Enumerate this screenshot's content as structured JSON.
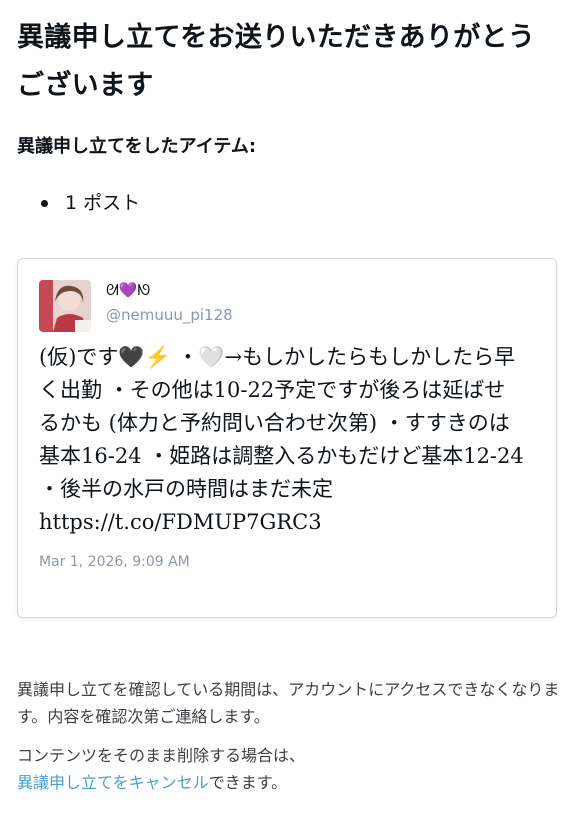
{
  "header": {
    "title": "異議申し立てをお送りいただきありがとうございます"
  },
  "appeal": {
    "items_heading": "異議申し立てをしたアイテム:",
    "items": [
      "1 ポスト"
    ]
  },
  "post": {
    "display_name": "ᘛ💜ᘚ",
    "handle": "@nemuuu_pi128",
    "text": "(仮)です🖤⚡ ・🤍→もしかしたらもしかしたら早く出勤 ・その他は10-22予定ですが後ろは延ばせるかも (体力と予約問い合わせ次第) ・すすきのは基本16-24 ・姫路は調整入るかもだけど基本12-24 ・後半の水戸の時間はまだ未定 https://t.co/FDMUP7GRC3",
    "timestamp": "Mar 1, 2026, 9:09 AM"
  },
  "info": {
    "notice": "異議申し立てを確認している期間は、アカウントにアクセスできなくなります。内容を確認次第ご連絡します。",
    "delete_prefix": "コンテンツをそのまま削除する場合は、",
    "cancel_link": "異議申し立てをキャンセル",
    "delete_suffix": "できます。"
  },
  "colors": {
    "link": "#4a9fd0",
    "muted": "#8b98a5",
    "border": "#cfd9de"
  }
}
